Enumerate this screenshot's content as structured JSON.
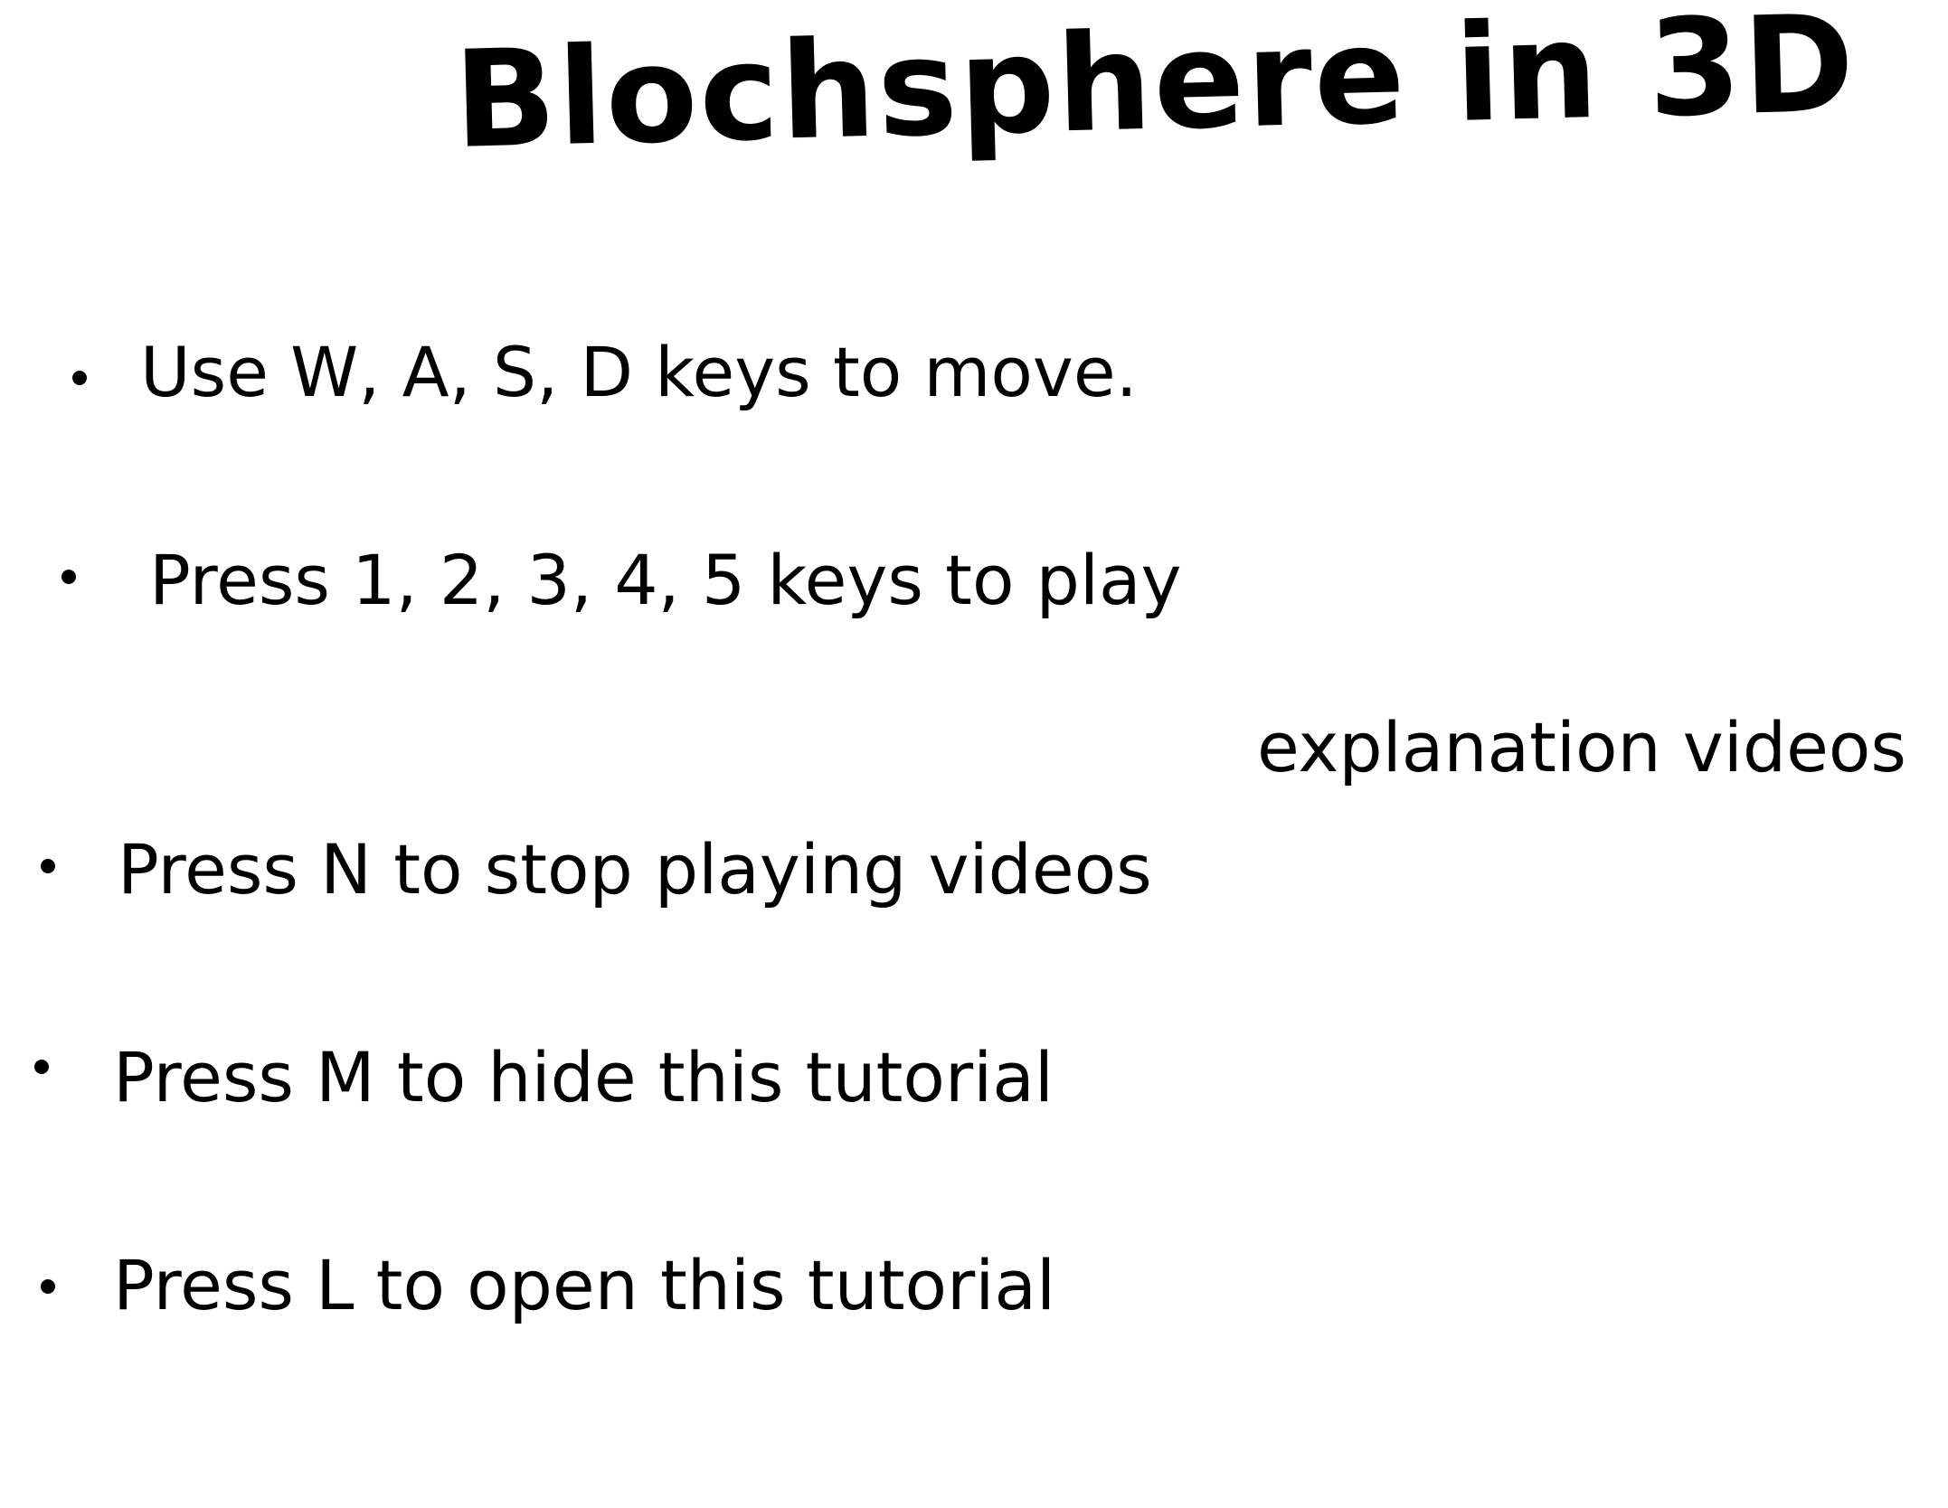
{
  "title": "Blochsphere in 3D",
  "instructions": [
    {
      "text": "Use W, A, S, D keys to move."
    },
    {
      "text": "Press 1, 2, 3, 4, 5 keys to play",
      "continuation": "explanation videos"
    },
    {
      "text": "Press N to stop playing videos"
    },
    {
      "text": "Press M to hide this tutorial"
    },
    {
      "text": "Press L to open this tutorial"
    }
  ]
}
